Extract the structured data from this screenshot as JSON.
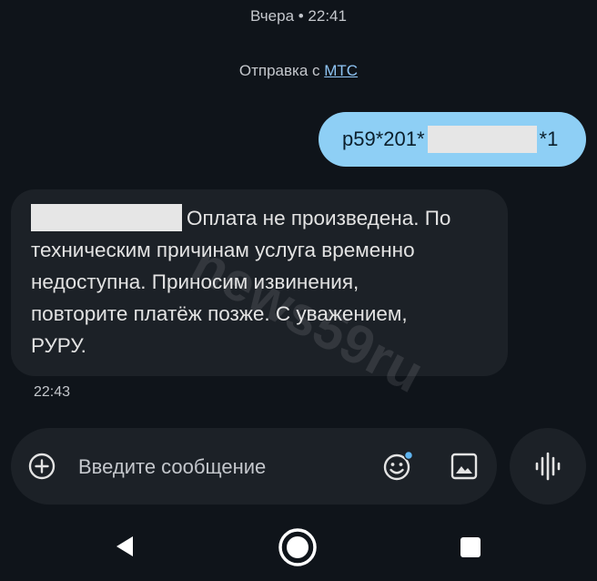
{
  "thread": {
    "date_label": "Вчера • 22:41",
    "sender_prefix": "Отправка с ",
    "sender_link": "МТС"
  },
  "outgoing": {
    "text_before": "р59*201*",
    "text_after": "*1"
  },
  "incoming": {
    "line1": "Оплата не произведена. По",
    "line2": "техническим причинам услуга временно",
    "line3": "недоступна. Приносим извинения,",
    "line4": "повторите платёж позже. С уважением,",
    "line5": "РУРУ.",
    "time": "22:43"
  },
  "watermark": "news59ru",
  "composer": {
    "placeholder": "Введите сообщение",
    "icons": [
      "add-icon",
      "emoji-icon",
      "image-icon",
      "voice-icon"
    ]
  },
  "navbar": {
    "icons": [
      "back-icon",
      "home-icon",
      "recents-icon"
    ]
  },
  "colors": {
    "background": "#0f141a",
    "bubble_out": "#8ecff5",
    "bubble_in": "#1c2127",
    "link": "#8fc5f5",
    "emoji_dot": "#5fb4f0"
  }
}
